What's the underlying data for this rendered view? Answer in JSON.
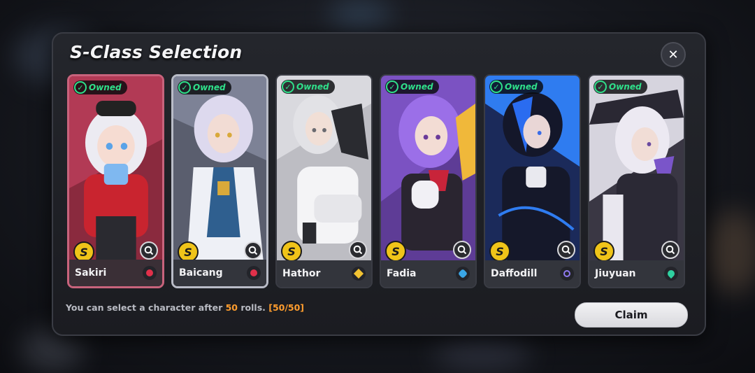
{
  "dialog": {
    "title": "S-Class Selection",
    "close_icon": "close-icon",
    "info_prefix": "You can select a character after ",
    "info_rolls": "50",
    "info_suffix": " rolls. ",
    "info_progress": "[50/50]",
    "claim_label": "Claim"
  },
  "cards": [
    {
      "name": "Sakiri",
      "owned_label": "Owned",
      "rank": "S",
      "element_color": "#e0304a",
      "accent": "#c94a62",
      "bg": "#7a2436",
      "hair": "#e8e6ef",
      "selected": true
    },
    {
      "name": "Baicang",
      "owned_label": "Owned",
      "rank": "S",
      "element_color": "#e0304a",
      "accent": "#9aa3c9",
      "bg": "#4a4d5e",
      "hair": "#d6d2e8",
      "selected": false
    },
    {
      "name": "Hathor",
      "owned_label": "Owned",
      "rank": "S",
      "element_color": "#f1c232",
      "accent": "#d8d8dd",
      "bg": "#cfcfd3",
      "hair": "#e9e9ec",
      "selected": false
    },
    {
      "name": "Fadia",
      "owned_label": "Owned",
      "rank": "S",
      "element_color": "#3aa6e6",
      "accent": "#8b5cd6",
      "bg": "#5c3a96",
      "hair": "#9b6fe8",
      "selected": false
    },
    {
      "name": "Daffodill",
      "owned_label": "Owned",
      "rank": "S",
      "element_color": "#8f7af0",
      "accent": "#2d7bf0",
      "bg": "#1c2a55",
      "hair": "#1a1d2e",
      "selected": false
    },
    {
      "name": "Jiuyuan",
      "owned_label": "Owned",
      "rank": "S",
      "element_color": "#2fd0a0",
      "accent": "#7a55c9",
      "bg": "#2e2b3a",
      "hair": "#e7e3ee",
      "selected": false
    }
  ]
}
